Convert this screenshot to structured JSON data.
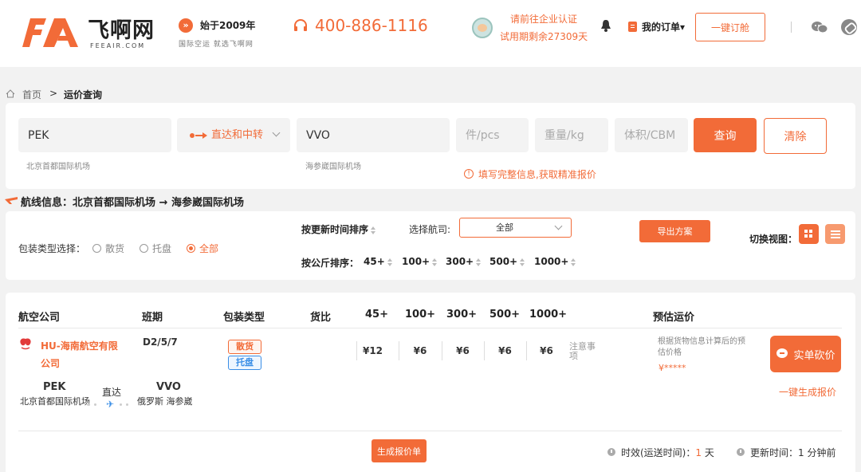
{
  "header": {
    "logo_text": "飞啊网",
    "logo_sub": "FEEAIR.COM",
    "since_title": "始于2009年",
    "since_sub": "国际空运 就选飞啊网",
    "phone": "400-886-1116",
    "cert_line1": "请前往企业认证",
    "cert_line2": "试用期剩余27309天",
    "my_orders": "我的订单▾",
    "book_button": "一键订舱"
  },
  "breadcrumb": {
    "home": "首页",
    "sep": ">",
    "current": "运价查询"
  },
  "search": {
    "origin_value": "PEK",
    "origin_name": "北京首都国际机场",
    "route_type": "直达和中转",
    "dest_value": "VVO",
    "dest_name": "海参崴国际机场",
    "pcs_placeholder": "件/pcs",
    "weight_placeholder": "重量/kg",
    "volume_placeholder": "体积/CBM",
    "query_button": "查询",
    "clear_button": "清除",
    "warning": "填写完整信息,获取精准报价"
  },
  "route_info": "航线信息：北京首都国际机场 → 海参崴国际机场",
  "filters": {
    "pack_label": "包装类型选择：",
    "pack_options": [
      "散货",
      "托盘",
      "全部"
    ],
    "pack_selected": "全部",
    "sort_update": "按更新时间排序",
    "sort_kg": "按公斤排序：",
    "kg_options": [
      "45+",
      "100+",
      "300+",
      "500+",
      "1000+"
    ],
    "airline_label": "选择航司:",
    "airline_selected": "全部",
    "export_button": "导出方案",
    "view_label": "切换视图："
  },
  "table": {
    "headers": [
      "航空公司",
      "班期",
      "包装类型",
      "货比",
      "45+",
      "100+",
      "300+",
      "500+",
      "1000+",
      "预估运价"
    ],
    "row": {
      "airline": "HU-海南航空有限公司",
      "schedule": "D2/5/7",
      "pack_bulk": "散货",
      "pack_pallet": "托盘",
      "prices": [
        "¥12",
        "¥6",
        "¥6",
        "¥6",
        "¥6"
      ],
      "note": "注意事项",
      "est_desc": "根据货物信息计算后的预估价格",
      "est_price": "¥*****",
      "bargain_button": "实单砍价",
      "quote_link": "一键生成报价",
      "origin_code": "PEK",
      "origin_name": "北京首都国际机场",
      "direct": "直达",
      "dest_code": "VVO",
      "dest_name": "俄罗斯 海参崴"
    }
  },
  "footer": {
    "generate_button": "生成报价单",
    "transit_label": "时效(运送时间)：",
    "transit_value": "1",
    "transit_unit": "天",
    "update_label": "更新时间：",
    "update_value": "1 分钟前"
  },
  "colors": {
    "accent": "#f26b38",
    "blue": "#3a8ee6",
    "background": "#f2f2f2"
  }
}
